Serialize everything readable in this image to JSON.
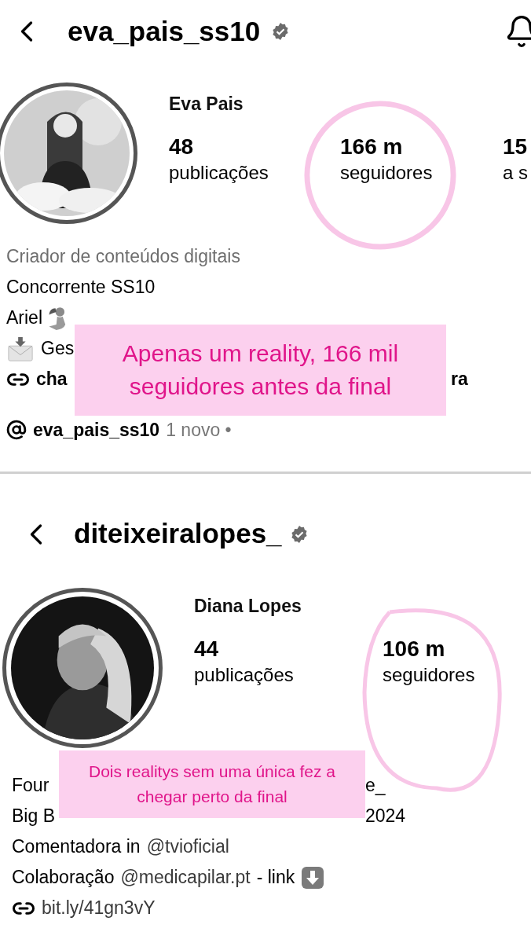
{
  "profiles": [
    {
      "username": "eva_pais_ss10",
      "verified": true,
      "show_bell": true,
      "display_name": "Eva Pais",
      "stats": [
        {
          "value": "48",
          "label": "publicações"
        },
        {
          "value": "166 m",
          "label": "seguidores"
        },
        {
          "value": "15",
          "label": "a s"
        }
      ],
      "bio": [
        {
          "left": [
            {
              "kind": "category",
              "text": "Criador de conteúdos digitais"
            }
          ]
        },
        {
          "left": [
            {
              "kind": "text",
              "text": "Concorrente SS10"
            }
          ]
        },
        {
          "left": [
            {
              "kind": "text",
              "text": "Ariel"
            },
            {
              "kind": "mermaid"
            }
          ]
        },
        {
          "left": [
            {
              "kind": "envelope"
            },
            {
              "kind": "text",
              "text": "Ges"
            }
          ]
        },
        {
          "left": [
            {
              "kind": "link"
            },
            {
              "kind": "bold",
              "text": "cha"
            }
          ],
          "right": [
            {
              "kind": "bold",
              "text": "ra"
            }
          ]
        }
      ],
      "threads": {
        "handle": "eva_pais_ss10",
        "badge": "1 novo •"
      },
      "annotation": {
        "text": "Apenas um reality, 166 mil seguidores antes da final"
      }
    },
    {
      "username": "diteixeiralopes_",
      "verified": true,
      "show_bell": false,
      "display_name": "Diana Lopes",
      "stats": [
        {
          "value": "44",
          "label": "publicações"
        },
        {
          "value": "106 m",
          "label": "seguidores"
        }
      ],
      "bio": [
        {
          "left": [
            {
              "kind": "text",
              "text": "Four"
            }
          ],
          "right": [
            {
              "kind": "text",
              "text": "e_"
            }
          ]
        },
        {
          "left": [
            {
              "kind": "text",
              "text": "Big B"
            }
          ],
          "right": [
            {
              "kind": "text",
              "text": "2024"
            }
          ]
        },
        {
          "left": [
            {
              "kind": "text",
              "text": "Comentadora in"
            },
            {
              "kind": "mention",
              "text": "@tvioficial"
            }
          ]
        },
        {
          "left": [
            {
              "kind": "text",
              "text": "Colaboração"
            },
            {
              "kind": "mention",
              "text": "@medicapilar.pt"
            },
            {
              "kind": "text",
              "text": "- link"
            },
            {
              "kind": "down"
            }
          ]
        },
        {
          "left": [
            {
              "kind": "link"
            },
            {
              "kind": "mention",
              "text": "bit.ly/41gn3vY"
            }
          ]
        }
      ],
      "annotation": {
        "text": "Dois realitys sem uma única fez a chegar perto da final"
      }
    }
  ]
}
